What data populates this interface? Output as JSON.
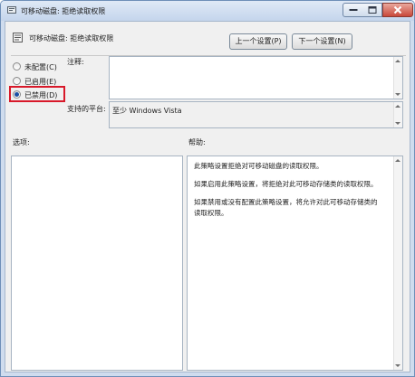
{
  "window": {
    "title": "可移动磁盘: 拒绝读取权限"
  },
  "header": {
    "policy_title": "可移动磁盘: 拒绝读取权限",
    "prev_button": "上一个设置(P)",
    "next_button": "下一个设置(N)"
  },
  "state": {
    "options": [
      {
        "label": "未配置(C)",
        "selected": false
      },
      {
        "label": "已启用(E)",
        "selected": false
      },
      {
        "label": "已禁用(D)",
        "selected": true
      }
    ]
  },
  "comment": {
    "label": "注释:",
    "value": ""
  },
  "platform": {
    "label": "支持的平台:",
    "value": "至少 Windows Vista"
  },
  "options_section": {
    "label": "选项:"
  },
  "help_section": {
    "label": "帮助:",
    "paragraphs": [
      "此策略设置拒绝对可移动磁盘的读取权限。",
      "如果启用此策略设置，将拒绝对此可移动存储类的读取权限。",
      "如果禁用或没有配置此策略设置，将允许对此可移动存储类的读取权限。"
    ]
  },
  "icons": [
    "app-icon",
    "policy-icon",
    "minimize-icon",
    "maximize-icon",
    "close-icon"
  ],
  "colors": {
    "highlight": "#d8192a",
    "titlebar": "#c4d5ec",
    "radio_selected": "#1b4fa3"
  }
}
